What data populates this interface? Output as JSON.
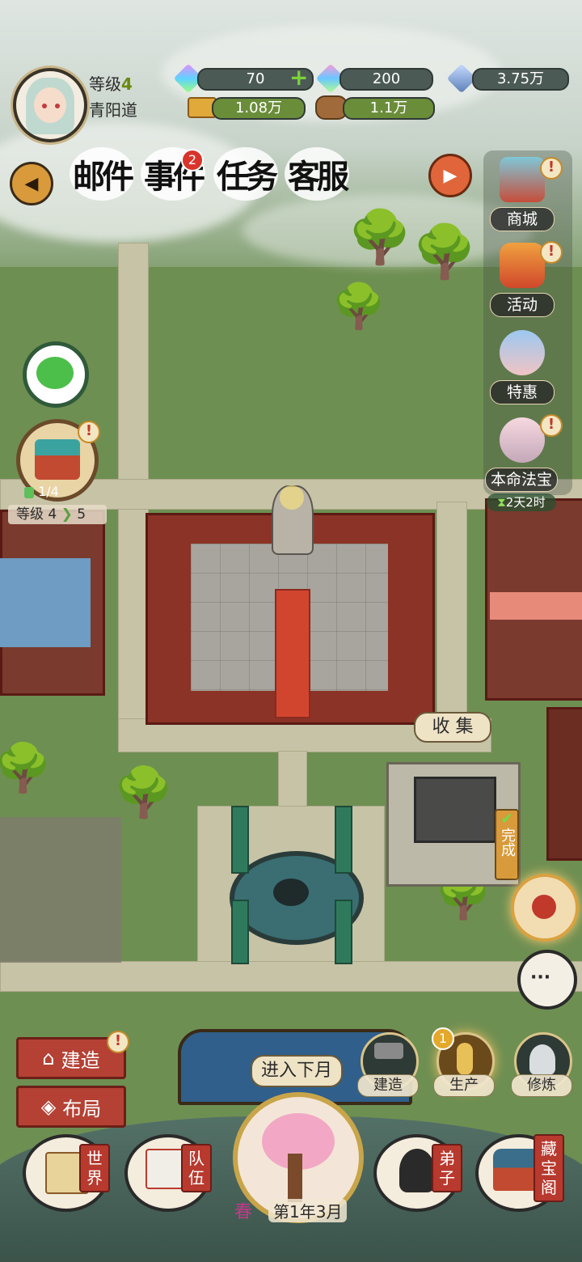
{
  "player": {
    "level_label": "等级",
    "level": "4",
    "name": "青阳道"
  },
  "resources": {
    "crystal1": "70",
    "crystal2": "200",
    "diamond": "3.75万",
    "gold": "1.08万",
    "wood": "1.1万"
  },
  "tabs": [
    {
      "label": "邮件"
    },
    {
      "label": "事件",
      "badge": "2"
    },
    {
      "label": "任务"
    },
    {
      "label": "客服"
    }
  ],
  "right_menu": {
    "shop": "商城",
    "activity": "活动",
    "special": "特惠",
    "treasure": "本命法宝",
    "timer": "2天2时"
  },
  "left_widgets": {
    "building_count": "1/4",
    "level_up_from": "等级 4",
    "level_up_to": "5"
  },
  "map_labels": {
    "collect": "收 集",
    "done": "完成"
  },
  "bottom": {
    "build_btn": "建造",
    "layout_btn": "布局",
    "next_month": "进入下月",
    "tool_build": "建造",
    "tool_produce": "生产",
    "tool_produce_badge": "1",
    "tool_cultivate": "修炼",
    "season": "春",
    "date": "第1年3月",
    "world": "世界",
    "team": "队伍",
    "disciples": "弟子",
    "treasury": "藏宝阁"
  },
  "colors": {
    "accent_red": "#b44134",
    "grass": "#6e8f52",
    "gold": "#d9c48a"
  }
}
